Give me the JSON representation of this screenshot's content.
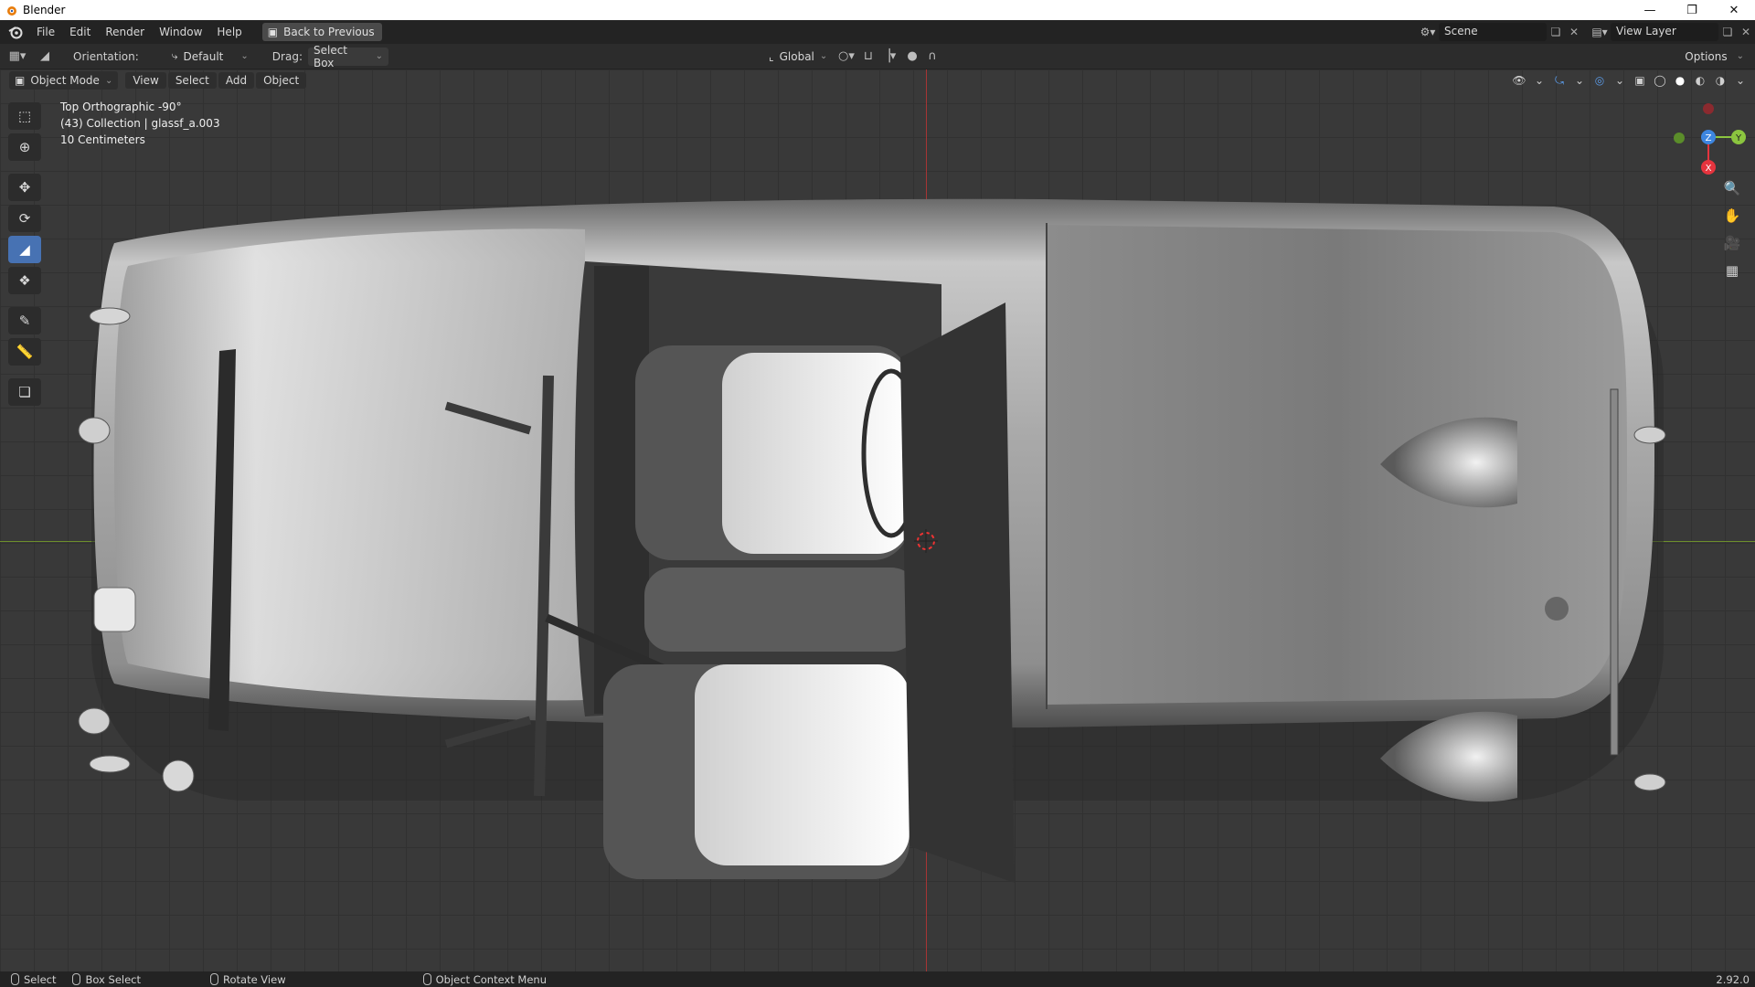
{
  "window": {
    "title": "Blender",
    "controls": [
      "minimize",
      "restore",
      "close"
    ]
  },
  "menubar": {
    "items": [
      "File",
      "Edit",
      "Render",
      "Window",
      "Help"
    ],
    "back_button": "Back to Previous",
    "scene": "Scene",
    "view_layer": "View Layer"
  },
  "toolheader": {
    "orientation_label": "Orientation:",
    "orientation_value": "Default",
    "drag_label": "Drag:",
    "drag_value": "Select Box",
    "transform_orientation": "Global",
    "options": "Options"
  },
  "viewheader": {
    "mode": "Object Mode",
    "menus": [
      "View",
      "Select",
      "Add",
      "Object"
    ]
  },
  "viewport": {
    "view_name": "Top Orthographic -90°",
    "collection_info": "(43) Collection | glassf_a.003",
    "scale_info": "10 Centimeters"
  },
  "gizmo": {
    "z_label": "Z",
    "y_label": "Y",
    "x_label": "X",
    "colors": {
      "x": "#e5343e",
      "y": "#8bc53f",
      "z": "#3d86e0"
    }
  },
  "tools": [
    "select-box",
    "cursor",
    "move",
    "rotate",
    "scale",
    "transform",
    "annotate",
    "measure",
    "add-cube"
  ],
  "active_tool": "scale",
  "statusbar": {
    "select": "Select",
    "box_select": "Box Select",
    "rotate_view": "Rotate View",
    "context_menu": "Object Context Menu",
    "version": "2.92.0"
  },
  "colors": {
    "accent": "#4772b3",
    "viewport_bg": "#393939"
  }
}
